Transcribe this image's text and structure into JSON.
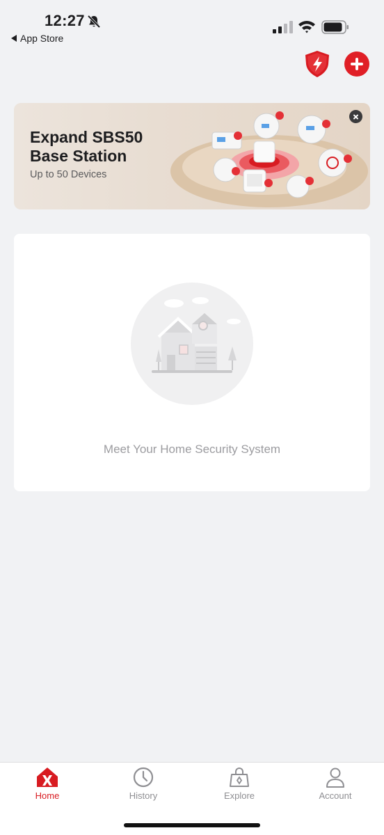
{
  "status_bar": {
    "time": "12:27",
    "back_label": "App Store"
  },
  "header": {
    "shield_icon": "shield-lightning-icon",
    "add_icon": "plus-circle-icon",
    "accent_color": "#e01f26"
  },
  "banner": {
    "title": "Expand SBS50 Base Station",
    "subtitle": "Up to 50 Devices"
  },
  "empty_state": {
    "message": "Meet Your Home Security System"
  },
  "tab_bar": {
    "active_tab": "Home",
    "tabs": [
      {
        "label": "Home",
        "icon": "home-logo-icon"
      },
      {
        "label": "History",
        "icon": "clock-icon"
      },
      {
        "label": "Explore",
        "icon": "shopping-bag-icon"
      },
      {
        "label": "Account",
        "icon": "person-icon"
      }
    ]
  }
}
